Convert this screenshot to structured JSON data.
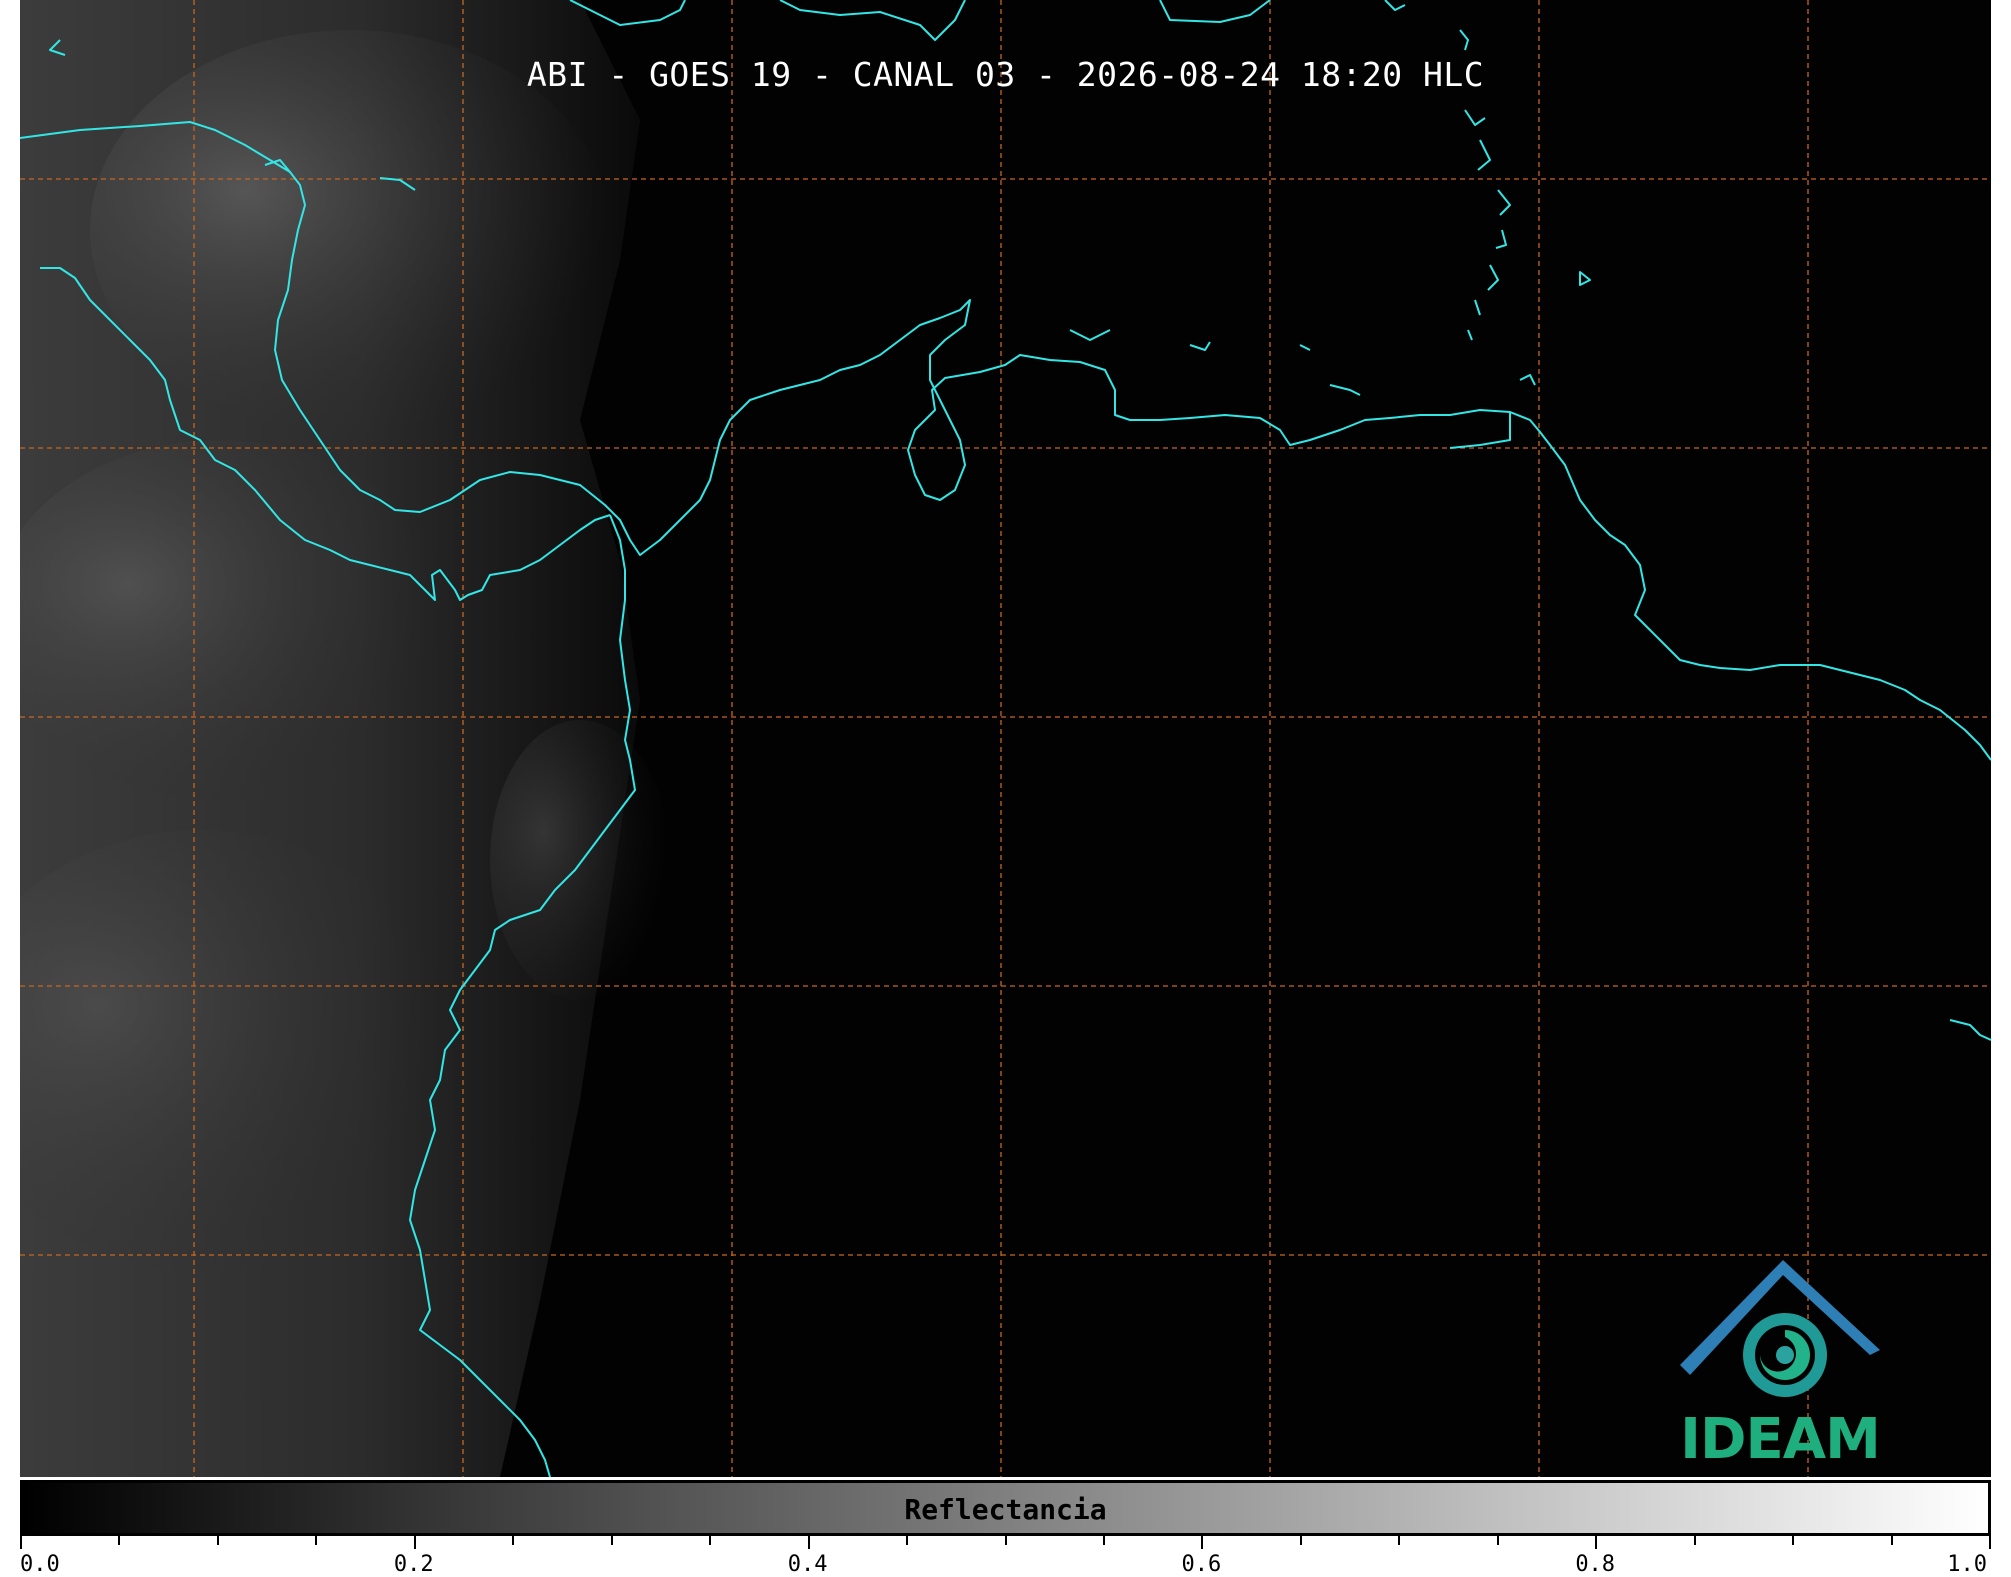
{
  "title": "ABI - GOES 19 - CANAL 03 - 2026-08-24 18:20 HLC",
  "colorbar": {
    "label": "Reflectancia",
    "min": 0.0,
    "max": 1.0,
    "tick_labels": [
      "0.0",
      "0.2",
      "0.4",
      "0.6",
      "0.8",
      "1.0"
    ],
    "minor_tick_step": 0.05,
    "colormap": "gray"
  },
  "logo": {
    "text": "IDEAM"
  },
  "colors": {
    "coastline": "#33e6e6",
    "gridline": "#c8661f",
    "background": "#020202",
    "logo_text": "#1fae7e",
    "logo_roof": "#2e7fb5"
  }
}
